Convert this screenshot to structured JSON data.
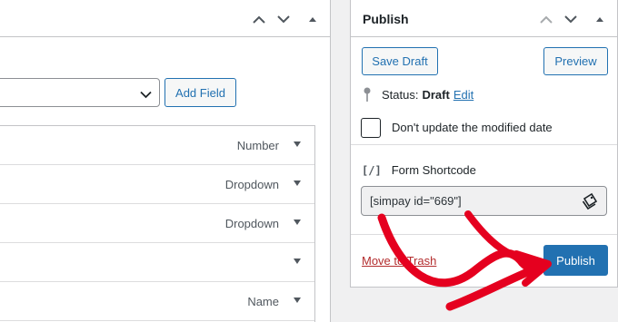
{
  "form_fields_panel": {
    "add_field_label": "Add Field",
    "fields": [
      {
        "type": "Number"
      },
      {
        "type": "Dropdown"
      },
      {
        "type": "Dropdown"
      },
      {
        "type": ""
      },
      {
        "type": "Name"
      }
    ]
  },
  "publish_box": {
    "title": "Publish",
    "save_draft_label": "Save Draft",
    "preview_label": "Preview",
    "status_label": "Status:",
    "status_value": "Draft",
    "status_edit_label": "Edit",
    "dont_update_label": "Don't update the modified date",
    "shortcode_icon_text": "[/]",
    "shortcode_label": "Form Shortcode",
    "shortcode_value": "[simpay id=\"669\"]",
    "move_to_trash_label": "Move to Trash",
    "publish_label": "Publish"
  },
  "colors": {
    "accent": "#2271b1",
    "annotation_arrow": "#e5001f",
    "trash": "#b32d2e"
  },
  "icons": [
    "chevron-up-icon",
    "chevron-down-icon",
    "collapse-triangle-icon",
    "pin-icon",
    "copy-icon",
    "code-icon",
    "select-chevron-icon",
    "caret-down-icon"
  ]
}
